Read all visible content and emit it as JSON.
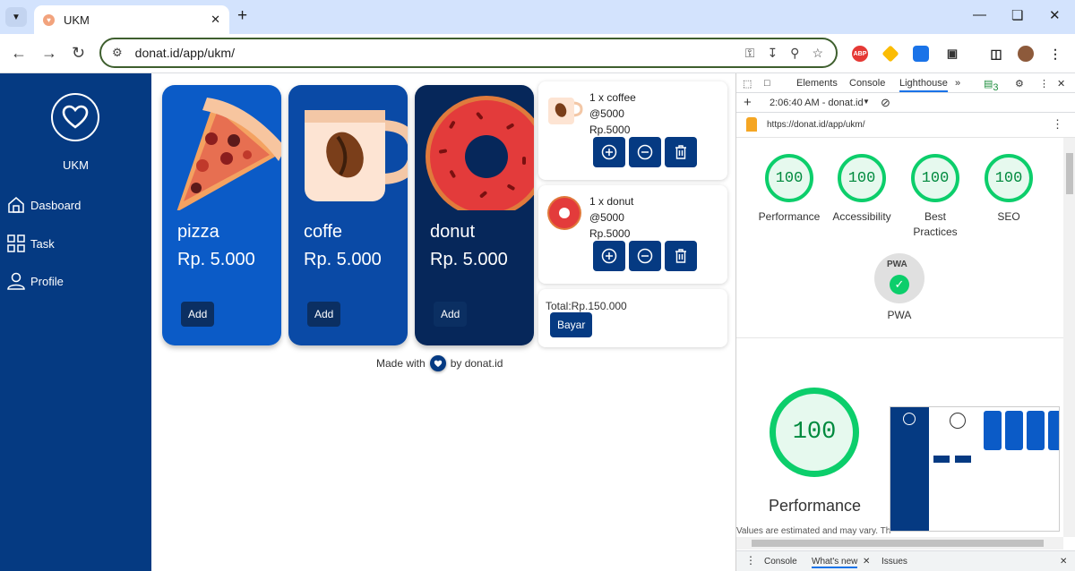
{
  "browser": {
    "tab_title": "UKM",
    "url": "donat.id/app/ukm/"
  },
  "app": {
    "brand": "UKM",
    "nav": [
      {
        "label": "Dasboard",
        "icon": "home-icon"
      },
      {
        "label": "Task",
        "icon": "grid-icon"
      },
      {
        "label": "Profile",
        "icon": "user-icon"
      }
    ],
    "products": [
      {
        "name": "pizza",
        "price": "Rp. 5.000",
        "add_label": "Add",
        "color": "#0b5bc7",
        "icon": "pizza-icon"
      },
      {
        "name": "coffe",
        "price": "Rp. 5.000",
        "add_label": "Add",
        "color": "#0a4aa6",
        "icon": "coffee-icon"
      },
      {
        "name": "donut",
        "price": "Rp. 5.000",
        "add_label": "Add",
        "color": "#06275a",
        "icon": "donut-icon"
      }
    ],
    "cart": [
      {
        "qty_line": "1 x coffee",
        "unit": "@5000",
        "subtotal": "Rp.5000",
        "icon": "coffee-icon"
      },
      {
        "qty_line": "1 x donut",
        "unit": "@5000",
        "subtotal": "Rp.5000",
        "icon": "donut-icon"
      }
    ],
    "total": "Total:Rp.150.000",
    "pay_label": "Bayar",
    "footer_pre": "Made with",
    "footer_post": "by donat.id"
  },
  "devtools": {
    "tabs": [
      "Elements",
      "Console",
      "Lighthouse"
    ],
    "issues_count": "3",
    "report_time": "2:06:40 AM - donat.id",
    "report_url": "https://donat.id/app/ukm/",
    "scores": [
      {
        "label": "Performance",
        "value": "100"
      },
      {
        "label": "Accessibility",
        "value": "100"
      },
      {
        "label": "Best Practices",
        "value": "100"
      },
      {
        "label": "SEO",
        "value": "100"
      }
    ],
    "pwa_label": "PWA",
    "pwa_badge": "PWA",
    "big_score": "100",
    "big_label": "Performance",
    "estimate_note": "Values are estimated and may vary. The",
    "drawer_tabs": [
      "Console",
      "What's new",
      "Issues"
    ],
    "accent": "#0cce6b"
  }
}
